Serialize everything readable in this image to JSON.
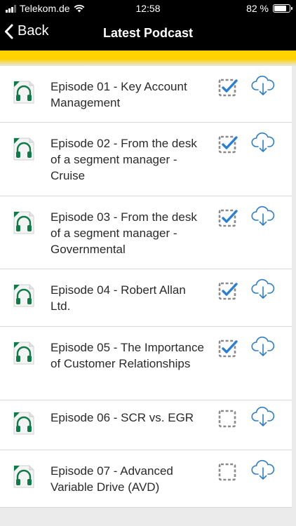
{
  "status_bar": {
    "carrier": "Telekom.de",
    "time": "12:58",
    "battery": "82 %",
    "battery_level": 0.82
  },
  "nav": {
    "back_label": "Back",
    "title": "Latest Podcast"
  },
  "colors": {
    "accent": "#ffd200",
    "icon_green": "#0f7a4a",
    "check_blue": "#2a7fd4",
    "cloud_blue": "#2f7fc4"
  },
  "episodes": [
    {
      "title": "Episode 01 - Key Account Management",
      "downloaded": true
    },
    {
      "title": "Episode 02 - From the desk of a segment manager - Cruise",
      "downloaded": true
    },
    {
      "title": "Episode 03 - From the desk of a segment manager - Governmental",
      "downloaded": true
    },
    {
      "title": "Episode 04 - Robert Allan Ltd.",
      "downloaded": true
    },
    {
      "title": "Episode 05 - The Importance of Customer Relationships",
      "downloaded": true
    },
    {
      "title": "Episode 06 - SCR vs. EGR",
      "downloaded": false
    },
    {
      "title": "Episode 07 - Advanced Variable Drive (AVD)",
      "downloaded": false
    }
  ]
}
